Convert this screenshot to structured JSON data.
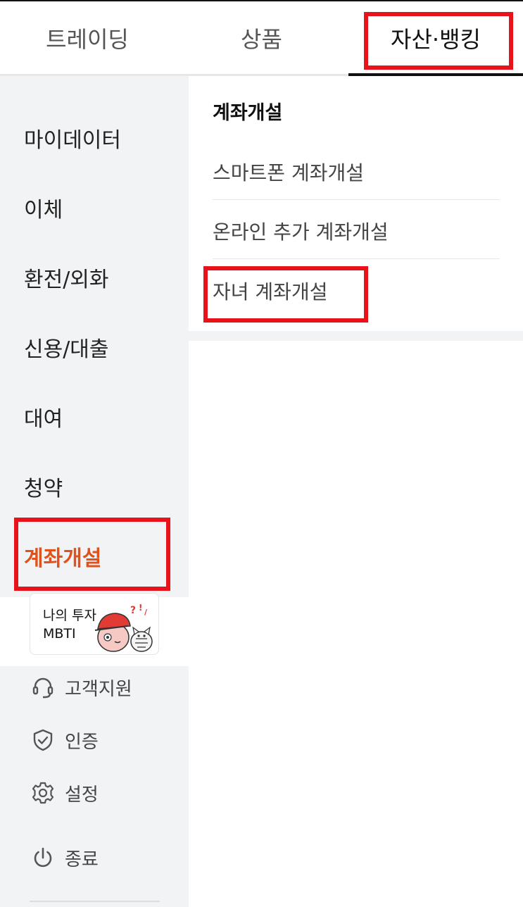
{
  "tabs": [
    {
      "label": "트레이딩"
    },
    {
      "label": "상품"
    },
    {
      "label": "자산·뱅킹"
    }
  ],
  "sidebar": {
    "items": [
      {
        "label": "마이데이터"
      },
      {
        "label": "이체"
      },
      {
        "label": "환전/외화"
      },
      {
        "label": "신용/대출"
      },
      {
        "label": "대여"
      },
      {
        "label": "청약"
      },
      {
        "label": "계좌개설"
      }
    ],
    "mbti_card": {
      "line1": "나의 투자",
      "line2": "MBTI"
    },
    "utilities": [
      {
        "label": "고객지원",
        "icon": "headset-icon"
      },
      {
        "label": "인증",
        "icon": "shield-check-icon"
      },
      {
        "label": "설정",
        "icon": "gear-icon"
      },
      {
        "label": "종료",
        "icon": "power-icon"
      }
    ]
  },
  "panel": {
    "title": "계좌개설",
    "items": [
      {
        "label": "스마트폰 계좌개설"
      },
      {
        "label": "온라인 추가 계좌개설"
      },
      {
        "label": "자녀 계좌개설"
      }
    ]
  },
  "colors": {
    "accent": "#e0511c",
    "highlight_box": "#e8121b",
    "sidebar_bg": "#f2f3f5"
  }
}
